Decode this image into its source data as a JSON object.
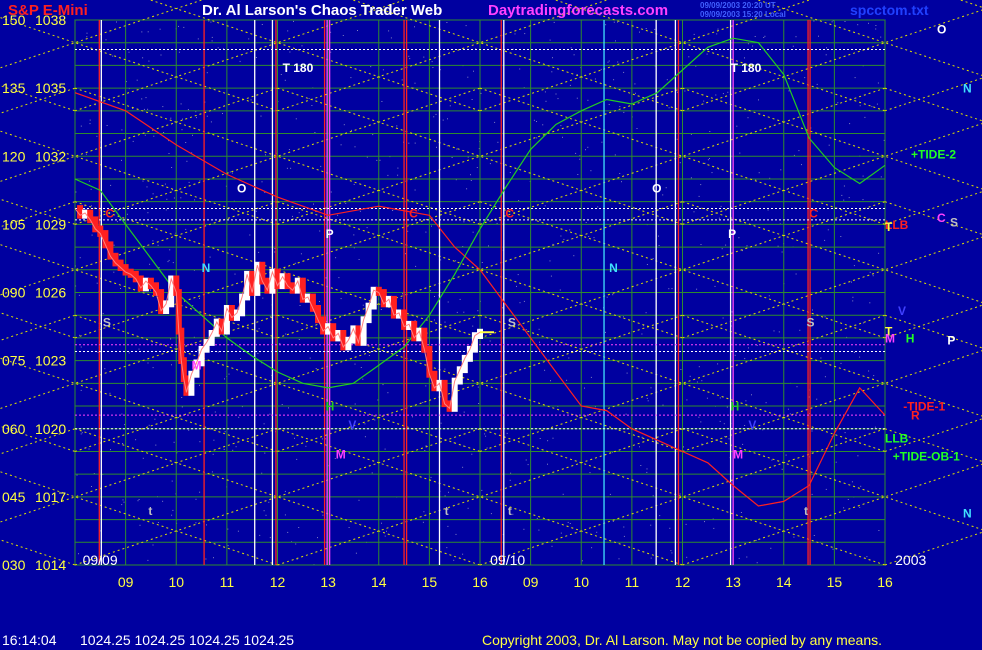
{
  "header": {
    "instrument": "S&P E-Mini",
    "site_title": "Dr. Al Larson's Chaos Trader Web",
    "website": "Daytradingforecasts.com",
    "stamp_line1": "09/09/2003 20:20 UT",
    "stamp_line2": "09/09/2003 15:20 Local",
    "filename": "spcctom.txt"
  },
  "footer": {
    "time": "16:14:04",
    "quotes": "1024.25 1024.25 1024.25 1024.25",
    "copyright": "Copyright 2003, Dr. Al Larson. May not be copied by any means."
  },
  "colors": {
    "background": "#0000a0",
    "grid": "#2e8b2e",
    "diamond": "#e0e000",
    "price_up": "#ffffff",
    "price_down": "#ff2020",
    "red_line": "#ff2020",
    "green_line": "#22cc22"
  },
  "chart_data": {
    "type": "line",
    "title": "S&P E-Mini",
    "left_scale": {
      "labels": [
        "150",
        "135",
        "120",
        "105",
        "090",
        "075",
        "060",
        "045",
        "030"
      ],
      "values": [
        150,
        135,
        120,
        105,
        90,
        75,
        60,
        45,
        30
      ]
    },
    "price_scale": {
      "labels": [
        "1038",
        "1035",
        "1032",
        "1029",
        "1026",
        "1023",
        "1020",
        "1017",
        "1014"
      ],
      "ylim": [
        1014,
        1038
      ]
    },
    "x_hours": [
      {
        "label": "09",
        "slot": 1
      },
      {
        "label": "10",
        "slot": 2
      },
      {
        "label": "11",
        "slot": 3
      },
      {
        "label": "12",
        "slot": 4
      },
      {
        "label": "13",
        "slot": 5
      },
      {
        "label": "14",
        "slot": 6
      },
      {
        "label": "15",
        "slot": 7
      },
      {
        "label": "16",
        "slot": 8
      },
      {
        "label": "09",
        "slot": 9
      },
      {
        "label": "10",
        "slot": 10
      },
      {
        "label": "11",
        "slot": 11
      },
      {
        "label": "12",
        "slot": 12
      },
      {
        "label": "13",
        "slot": 13
      },
      {
        "label": "14",
        "slot": 14
      },
      {
        "label": "15",
        "slot": 15
      },
      {
        "label": "16",
        "slot": 16
      }
    ],
    "date_labels": [
      {
        "label": "09/09",
        "slot": 0.15
      },
      {
        "label": "09/10",
        "slot": 8.2
      },
      {
        "label": "2003",
        "slot": 16.2
      }
    ],
    "price_series": {
      "name": "",
      "slots": [
        0.0,
        0.1,
        0.2,
        0.3,
        0.4,
        0.5,
        0.6,
        0.7,
        0.8,
        0.9,
        1.0,
        1.1,
        1.2,
        1.3,
        1.4,
        1.5,
        1.6,
        1.7,
        1.8,
        1.9,
        2.0,
        2.05,
        2.1,
        2.15,
        2.2,
        2.3,
        2.4,
        2.5,
        2.6,
        2.7,
        2.8,
        2.9,
        3.0,
        3.1,
        3.2,
        3.3,
        3.4,
        3.5,
        3.6,
        3.7,
        3.8,
        3.9,
        4.0,
        4.1,
        4.2,
        4.3,
        4.4,
        4.5,
        4.6,
        4.7,
        4.8,
        4.9,
        5.0,
        5.1,
        5.2,
        5.3,
        5.4,
        5.5,
        5.6,
        5.7,
        5.8,
        5.9,
        6.0,
        6.1,
        6.2,
        6.3,
        6.4,
        6.5,
        6.6,
        6.7,
        6.8,
        6.9,
        7.0,
        7.1,
        7.2,
        7.3,
        7.4,
        7.5,
        7.6,
        7.7,
        7.8,
        7.9,
        8.0
      ],
      "values": [
        1029.7,
        1029.4,
        1029.5,
        1029.2,
        1028.8,
        1028.6,
        1028.1,
        1027.6,
        1027.3,
        1027.1,
        1026.9,
        1026.8,
        1026.6,
        1026.2,
        1026.5,
        1026.3,
        1026.0,
        1025.2,
        1025.5,
        1026.6,
        1026.0,
        1024.3,
        1023.0,
        1022.2,
        1021.6,
        1022.4,
        1022.9,
        1023.5,
        1023.8,
        1024.2,
        1024.7,
        1024.3,
        1025.3,
        1024.9,
        1025.1,
        1025.8,
        1026.8,
        1026.0,
        1027.2,
        1026.5,
        1026.1,
        1026.9,
        1026.3,
        1026.7,
        1026.3,
        1026.1,
        1026.5,
        1025.7,
        1025.8,
        1025.3,
        1024.8,
        1024.3,
        1024.5,
        1024.0,
        1024.2,
        1023.6,
        1023.9,
        1024.4,
        1023.8,
        1024.8,
        1025.4,
        1026.1,
        1026.0,
        1025.5,
        1025.7,
        1025.0,
        1025.1,
        1024.5,
        1024.6,
        1024.0,
        1024.3,
        1023.5,
        1022.4,
        1021.8,
        1022.0,
        1021.1,
        1020.9,
        1022.1,
        1022.6,
        1023.1,
        1023.5,
        1024.1,
        1024.25
      ]
    },
    "red_curve": {
      "slots": [
        0,
        1,
        2,
        3,
        4,
        5,
        6,
        7,
        7.5,
        8,
        8.5,
        9,
        9.5,
        10,
        10.5,
        11,
        11.5,
        12,
        12.5,
        13,
        13.5,
        14,
        14.5,
        15,
        15.5,
        16
      ],
      "values": [
        1034.8,
        1034,
        1032.5,
        1031.2,
        1030.2,
        1029.4,
        1029.8,
        1029.4,
        1028,
        1027,
        1025.5,
        1024,
        1022.5,
        1021,
        1020.8,
        1020,
        1019.5,
        1019,
        1018.5,
        1017.5,
        1016.6,
        1016.8,
        1017.5,
        1019.8,
        1021.8,
        1020.6
      ]
    },
    "green_curve": {
      "slots": [
        0,
        0.5,
        1,
        1.5,
        2,
        2.5,
        3,
        3.5,
        4,
        4.5,
        5,
        5.5,
        6,
        6.5,
        7,
        7.5,
        8,
        8.5,
        9,
        9.5,
        10,
        10.5,
        11,
        11.5,
        12,
        12.5,
        13,
        13.5,
        14,
        14.5,
        15,
        15.5,
        16
      ],
      "values": [
        1031,
        1030.5,
        1029,
        1027.5,
        1026,
        1025,
        1024,
        1023.2,
        1022.5,
        1022,
        1021.8,
        1022,
        1022.8,
        1023.6,
        1025,
        1026.8,
        1028.8,
        1030.6,
        1032.3,
        1033.4,
        1034.0,
        1034.5,
        1034.3,
        1034.8,
        1035.8,
        1036.8,
        1037.2,
        1037.0,
        1035.6,
        1032.8,
        1031.5,
        1030.8,
        1031.6
      ]
    },
    "vertical_lines": [
      {
        "slot": 0.48,
        "color": "#ff2020"
      },
      {
        "slot": 0.52,
        "color": "#ffffff"
      },
      {
        "slot": 2.55,
        "color": "#ff2020"
      },
      {
        "slot": 3.55,
        "color": "#ffffff"
      },
      {
        "slot": 3.9,
        "color": "#ffffff"
      },
      {
        "slot": 3.97,
        "color": "#ff2020"
      },
      {
        "slot": 4.93,
        "color": "#ff2020"
      },
      {
        "slot": 4.98,
        "color": "#ff40ff"
      },
      {
        "slot": 5.03,
        "color": "#ff40ff"
      },
      {
        "slot": 6.5,
        "color": "#ff2020"
      },
      {
        "slot": 6.55,
        "color": "#ff2020"
      },
      {
        "slot": 7.2,
        "color": "#ffffff"
      },
      {
        "slot": 8.42,
        "color": "#ff2020"
      },
      {
        "slot": 8.47,
        "color": "#ffffff"
      },
      {
        "slot": 10.45,
        "color": "#40e0ff"
      },
      {
        "slot": 11.48,
        "color": "#ffffff"
      },
      {
        "slot": 11.86,
        "color": "#ffffff"
      },
      {
        "slot": 11.92,
        "color": "#ff2020"
      },
      {
        "slot": 12.95,
        "color": "#ffffff"
      },
      {
        "slot": 13.0,
        "color": "#ff40ff"
      },
      {
        "slot": 14.48,
        "color": "#ff2020"
      },
      {
        "slot": 14.52,
        "color": "#ff2020"
      }
    ],
    "horizontal_lines": [
      {
        "price": 1036.7,
        "color": "#ffffff"
      },
      {
        "price": 1029.7,
        "color": "#ffffff"
      },
      {
        "price": 1029.2,
        "color": "#ffffff"
      },
      {
        "price": 1023.7,
        "color": "#ff40ff"
      },
      {
        "price": 1023.4,
        "color": "#ffffff"
      },
      {
        "price": 1020.6,
        "color": "#ff40ff"
      },
      {
        "price": 1020.0,
        "color": "#ffffff"
      }
    ],
    "annotations": [
      {
        "text": "T 180",
        "slot": 4.1,
        "price": 1035.7,
        "color": "#ffffff"
      },
      {
        "text": "T 180",
        "slot": 12.95,
        "price": 1035.7,
        "color": "#ffffff"
      },
      {
        "text": "O",
        "slot": 3.2,
        "price": 1030.4,
        "color": "#ffffff"
      },
      {
        "text": "O",
        "slot": 11.4,
        "price": 1030.4,
        "color": "#ffffff"
      },
      {
        "text": "C",
        "slot": 0.6,
        "price": 1029.3,
        "color": "#ff2020"
      },
      {
        "text": "C",
        "slot": 6.6,
        "price": 1029.3,
        "color": "#ff2020"
      },
      {
        "text": "C",
        "slot": 8.5,
        "price": 1029.3,
        "color": "#ff2020"
      },
      {
        "text": "C",
        "slot": 14.5,
        "price": 1029.3,
        "color": "#ff2020"
      },
      {
        "text": "P",
        "slot": 4.95,
        "price": 1028.4,
        "color": "#ffffff"
      },
      {
        "text": "P",
        "slot": 12.9,
        "price": 1028.4,
        "color": "#ffffff"
      },
      {
        "text": "N",
        "slot": 2.5,
        "price": 1026.9,
        "color": "#40e0ff"
      },
      {
        "text": "N",
        "slot": 10.55,
        "price": 1026.9,
        "color": "#40e0ff"
      },
      {
        "text": "S",
        "slot": 0.55,
        "price": 1024.5,
        "color": "#c0c0c0"
      },
      {
        "text": "S",
        "slot": 8.55,
        "price": 1024.5,
        "color": "#c0c0c0"
      },
      {
        "text": "S",
        "slot": 14.45,
        "price": 1024.5,
        "color": "#c0c0c0"
      },
      {
        "text": "M",
        "slot": 2.3,
        "price": 1022.6,
        "color": "#ff40ff"
      },
      {
        "text": "H",
        "slot": 4.95,
        "price": 1020.8,
        "color": "#22cc22"
      },
      {
        "text": "H",
        "slot": 12.95,
        "price": 1020.8,
        "color": "#22cc22"
      },
      {
        "text": "V",
        "slot": 5.4,
        "price": 1020.0,
        "color": "#4040ff"
      },
      {
        "text": "V",
        "slot": 13.3,
        "price": 1020.0,
        "color": "#4040ff"
      },
      {
        "text": "M",
        "slot": 5.15,
        "price": 1018.7,
        "color": "#ff40ff"
      },
      {
        "text": "M",
        "slot": 13.0,
        "price": 1018.7,
        "color": "#ff40ff"
      },
      {
        "text": "t",
        "slot": 1.45,
        "price": 1016.2,
        "color": "#c0c0c0"
      },
      {
        "text": "t",
        "slot": 7.3,
        "price": 1016.2,
        "color": "#c0c0c0"
      },
      {
        "text": "t",
        "slot": 8.55,
        "price": 1016.2,
        "color": "#c0c0c0"
      },
      {
        "text": "t",
        "slot": 14.4,
        "price": 1016.2,
        "color": "#c0c0c0"
      }
    ],
    "right_labels": [
      {
        "text": "O",
        "price": 1037.4,
        "color": "#ffffff",
        "col": 2
      },
      {
        "text": "N",
        "price": 1034.8,
        "color": "#40e0ff",
        "col": 3
      },
      {
        "text": "+TIDE-2",
        "price": 1031.9,
        "color": "#22ff22",
        "col": 1
      },
      {
        "text": "LLB",
        "price": 1028.8,
        "color": "#ff2020",
        "col": 0
      },
      {
        "text": "T",
        "price": 1028.7,
        "color": "#ffff40",
        "col": 0
      },
      {
        "text": "C",
        "price": 1029.1,
        "color": "#ff40ff",
        "col": 2
      },
      {
        "text": "S",
        "price": 1028.9,
        "color": "#c0c0c0",
        "col": 2.5
      },
      {
        "text": "V",
        "price": 1025.0,
        "color": "#4040ff",
        "col": 0.5
      },
      {
        "text": "T",
        "price": 1024.1,
        "color": "#ffff40",
        "col": 0
      },
      {
        "text": "M",
        "price": 1023.8,
        "color": "#ff40ff",
        "col": 0
      },
      {
        "text": "H",
        "price": 1023.8,
        "color": "#22ff22",
        "col": 0.8
      },
      {
        "text": "P",
        "price": 1023.7,
        "color": "#ffffff",
        "col": 2.4
      },
      {
        "text": "-TIDE-1",
        "price": 1020.8,
        "color": "#ff2020",
        "col": 0.7
      },
      {
        "text": "R",
        "price": 1020.4,
        "color": "#ff2020",
        "col": 1.0
      },
      {
        "text": "LLB",
        "price": 1019.4,
        "color": "#22ff22",
        "col": 0
      },
      {
        "text": "+TIDE-OB-1",
        "price": 1018.6,
        "color": "#22ff22",
        "col": 0.3
      },
      {
        "text": "N",
        "price": 1016.1,
        "color": "#40e0ff",
        "col": 3
      }
    ]
  }
}
